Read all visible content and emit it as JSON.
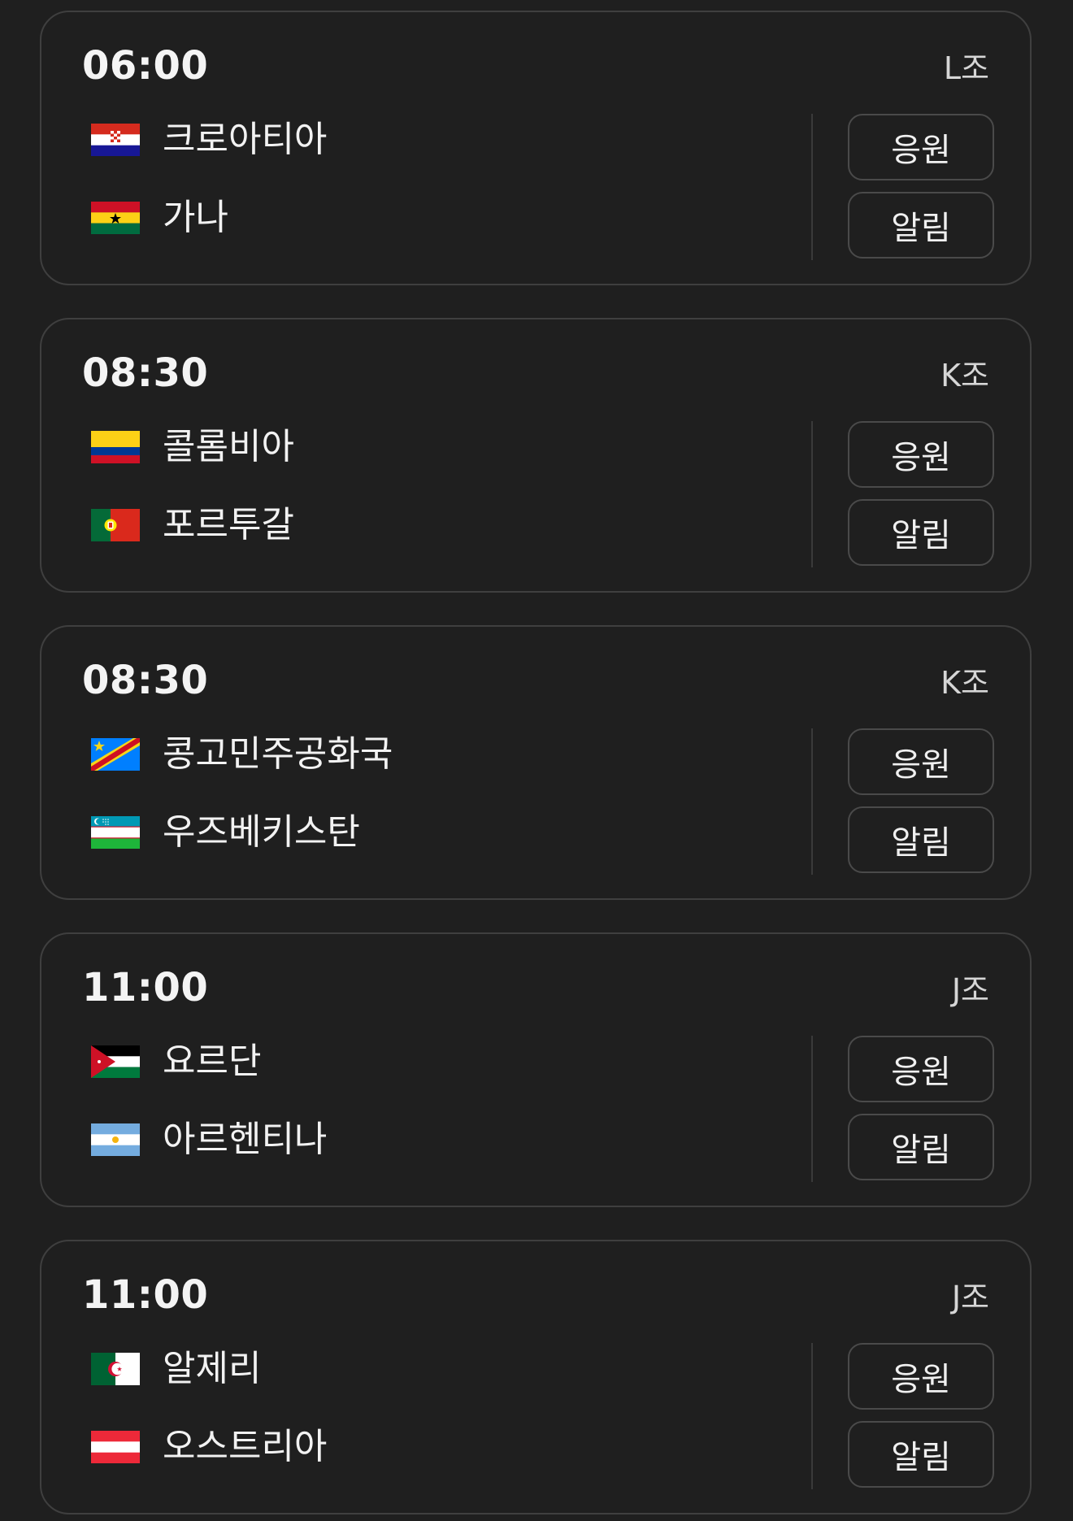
{
  "matches": [
    {
      "time": "06:00",
      "group": "L조",
      "team1": {
        "name": "크로아티아",
        "flag": "croatia-flag"
      },
      "team2": {
        "name": "가나",
        "flag": "ghana-flag"
      },
      "cheer_label": "응원",
      "alert_label": "알림"
    },
    {
      "time": "08:30",
      "group": "K조",
      "team1": {
        "name": "콜롬비아",
        "flag": "colombia-flag"
      },
      "team2": {
        "name": "포르투갈",
        "flag": "portugal-flag"
      },
      "cheer_label": "응원",
      "alert_label": "알림"
    },
    {
      "time": "08:30",
      "group": "K조",
      "team1": {
        "name": "콩고민주공화국",
        "flag": "dr-congo-flag"
      },
      "team2": {
        "name": "우즈베키스탄",
        "flag": "uzbekistan-flag"
      },
      "cheer_label": "응원",
      "alert_label": "알림"
    },
    {
      "time": "11:00",
      "group": "J조",
      "team1": {
        "name": "요르단",
        "flag": "jordan-flag"
      },
      "team2": {
        "name": "아르헨티나",
        "flag": "argentina-flag"
      },
      "cheer_label": "응원",
      "alert_label": "알림"
    },
    {
      "time": "11:00",
      "group": "J조",
      "team1": {
        "name": "알제리",
        "flag": "algeria-flag"
      },
      "team2": {
        "name": "오스트리아",
        "flag": "austria-flag"
      },
      "cheer_label": "응원",
      "alert_label": "알림"
    }
  ],
  "colors": {
    "background": "#1f1f1f",
    "card_border": "#3f3f3f",
    "button_border": "#4a4a4a",
    "text": "#f2f2f2",
    "secondary_text": "#d6d6d6"
  }
}
